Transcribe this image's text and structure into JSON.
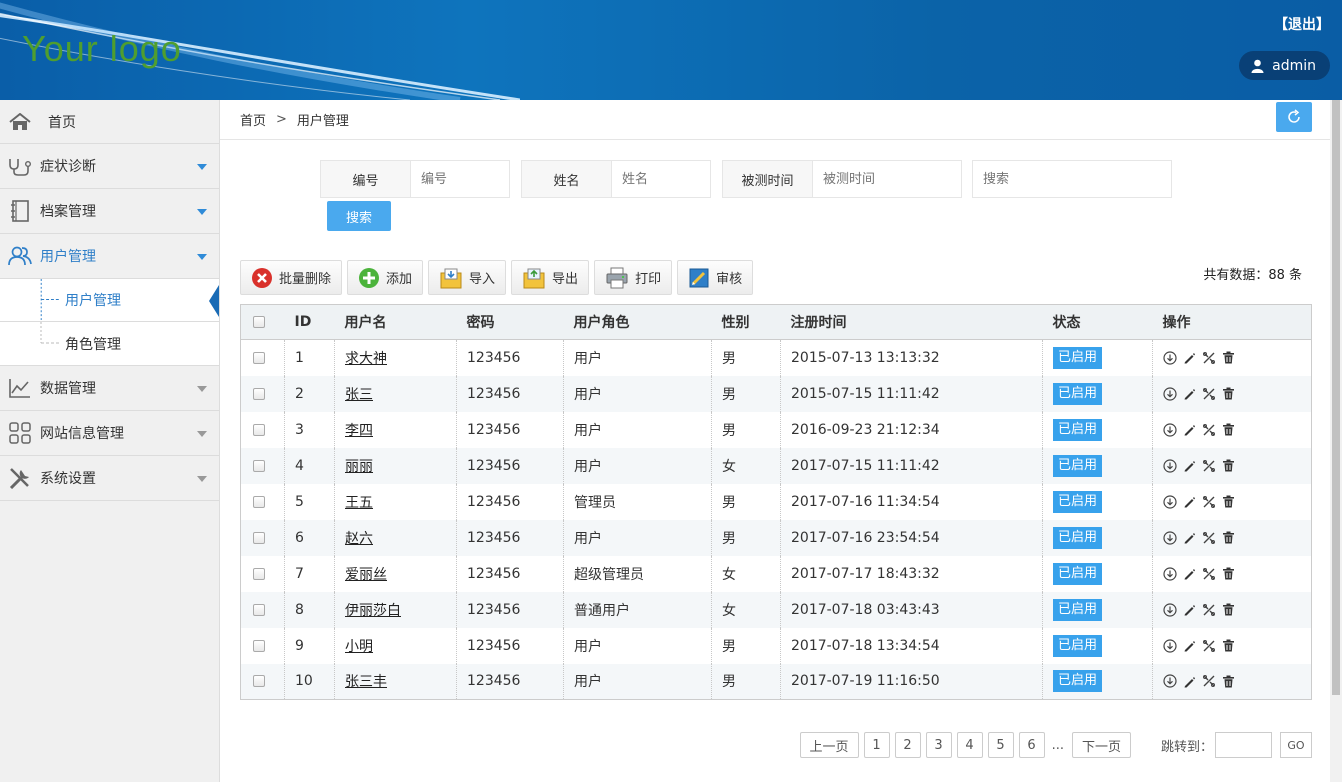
{
  "header": {
    "logo_text": "Your logo",
    "logout_label": "【退出】",
    "username": "admin"
  },
  "sidebar": {
    "home": {
      "label": "首页",
      "icon": "home-icon"
    },
    "items": [
      {
        "label": "症状诊断",
        "icon": "stethoscope-icon"
      },
      {
        "label": "档案管理",
        "icon": "notebook-icon"
      },
      {
        "label": "用户管理",
        "icon": "users-icon"
      },
      {
        "label": "数据管理",
        "icon": "line-chart-icon"
      },
      {
        "label": "网站信息管理",
        "icon": "grid-icon"
      },
      {
        "label": "系统设置",
        "icon": "tools-icon"
      }
    ],
    "subitems": [
      {
        "label": "用户管理"
      },
      {
        "label": "角色管理"
      }
    ]
  },
  "breadcrumb": {
    "home": "首页",
    "separator": ">",
    "current": "用户管理"
  },
  "search": {
    "fields": [
      {
        "label": "编号",
        "placeholder": "编号"
      },
      {
        "label": "姓名",
        "placeholder": "姓名"
      },
      {
        "label": "被测时间",
        "placeholder": "被测时间"
      }
    ],
    "keyword_placeholder": "搜索",
    "button_label": "搜索"
  },
  "toolbar": {
    "buttons": [
      {
        "label": "批量删除",
        "icon": "delete-circle-icon"
      },
      {
        "label": "添加",
        "icon": "add-circle-icon"
      },
      {
        "label": "导入",
        "icon": "import-icon"
      },
      {
        "label": "导出",
        "icon": "export-icon"
      },
      {
        "label": "打印",
        "icon": "printer-icon"
      },
      {
        "label": "审核",
        "icon": "review-icon"
      }
    ],
    "total": "共有数据：88 条"
  },
  "table": {
    "headers": [
      "ID",
      "用户名",
      "密码",
      "用户角色",
      "性别",
      "注册时间",
      "状态",
      "操作"
    ],
    "rows": [
      {
        "id": "1",
        "name": "求大神",
        "password": "123456",
        "role": "用户",
        "gender": "男",
        "time": "2015-07-13 13:13:32",
        "status": "已启用"
      },
      {
        "id": "2",
        "name": "张三",
        "password": "123456",
        "role": "用户",
        "gender": "男",
        "time": "2015-07-15 11:11:42",
        "status": "已启用"
      },
      {
        "id": "3",
        "name": "李四",
        "password": "123456",
        "role": "用户",
        "gender": "男",
        "time": "2016-09-23 21:12:34",
        "status": "已启用"
      },
      {
        "id": "4",
        "name": "丽丽",
        "password": "123456",
        "role": "用户",
        "gender": "女",
        "time": "2017-07-15 11:11:42",
        "status": "已启用"
      },
      {
        "id": "5",
        "name": "王五",
        "password": "123456",
        "role": "管理员",
        "gender": "男",
        "time": "2017-07-16 11:34:54",
        "status": "已启用"
      },
      {
        "id": "6",
        "name": "赵六",
        "password": "123456",
        "role": "用户",
        "gender": "男",
        "time": "2017-07-16 23:54:54",
        "status": "已启用"
      },
      {
        "id": "7",
        "name": "爱丽丝",
        "password": "123456",
        "role": "超级管理员",
        "gender": "女",
        "time": "2017-07-17 18:43:32",
        "status": "已启用"
      },
      {
        "id": "8",
        "name": "伊丽莎白",
        "password": "123456",
        "role": "普通用户",
        "gender": "女",
        "time": "2017-07-18 03:43:43",
        "status": "已启用"
      },
      {
        "id": "9",
        "name": "小明",
        "password": "123456",
        "role": "用户",
        "gender": "男",
        "time": "2017-07-18 13:34:54",
        "status": "已启用"
      },
      {
        "id": "10",
        "name": "张三丰",
        "password": "123456",
        "role": "用户",
        "gender": "男",
        "time": "2017-07-19 11:16:50",
        "status": "已启用"
      }
    ]
  },
  "pagination": {
    "prev": "上一页",
    "pages": [
      "1",
      "2",
      "3",
      "4",
      "5",
      "6"
    ],
    "ellipsis": "...",
    "next": "下一页",
    "jump_label": "跳转到：",
    "go": "GO"
  },
  "colors": {
    "header_bg": "#0b66ad",
    "accent": "#4aa9ee",
    "badge": "#38a2ec",
    "logo": "#4f9e2f"
  }
}
